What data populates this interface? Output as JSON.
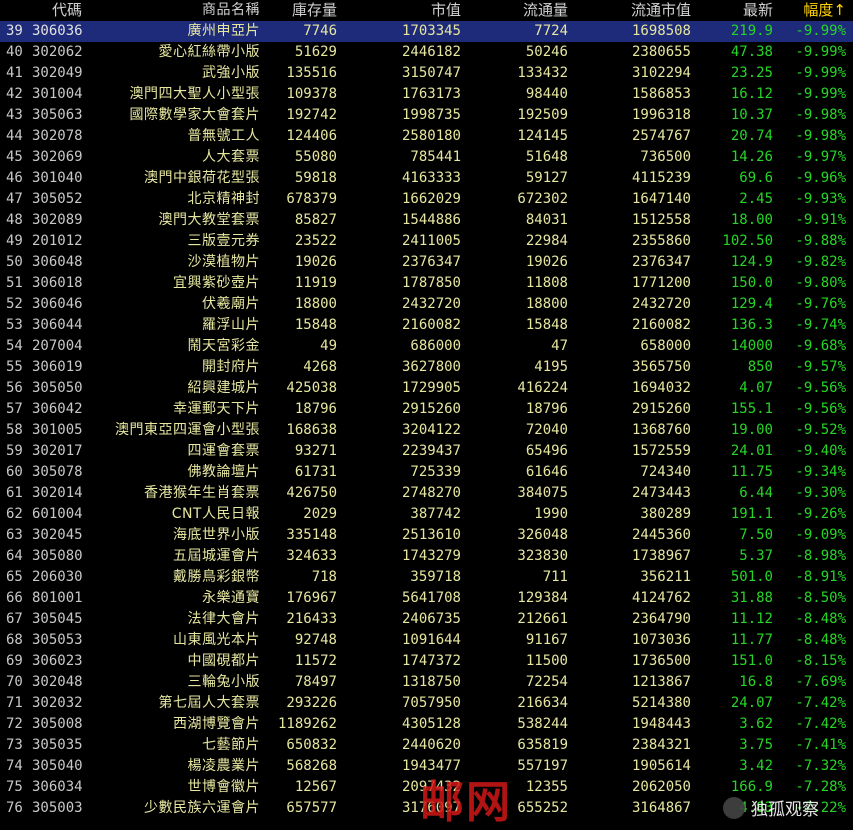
{
  "header": {
    "code": "代碼",
    "name": "商品名稱",
    "inventory": "庫存量",
    "market_value": "市值",
    "circulation": "流通量",
    "circ_market_value": "流通市值",
    "last": "最新",
    "change": "幅度↑"
  },
  "rows": [
    {
      "idx": "39",
      "code": "306036",
      "name": "廣州申亞片",
      "inventory": "7746",
      "market_value": "1703345",
      "circulation": "7724",
      "circ_market_value": "1698508",
      "last": "219.9",
      "change": "-9.99%"
    },
    {
      "idx": "40",
      "code": "302062",
      "name": "愛心紅絲帶小版",
      "inventory": "51629",
      "market_value": "2446182",
      "circulation": "50246",
      "circ_market_value": "2380655",
      "last": "47.38",
      "change": "-9.99%"
    },
    {
      "idx": "41",
      "code": "302049",
      "name": "武強小版",
      "inventory": "135516",
      "market_value": "3150747",
      "circulation": "133432",
      "circ_market_value": "3102294",
      "last": "23.25",
      "change": "-9.99%"
    },
    {
      "idx": "42",
      "code": "301004",
      "name": "澳門四大聖人小型張",
      "inventory": "109378",
      "market_value": "1763173",
      "circulation": "98440",
      "circ_market_value": "1586853",
      "last": "16.12",
      "change": "-9.99%"
    },
    {
      "idx": "43",
      "code": "305063",
      "name": "國際數學家大會套片",
      "inventory": "192742",
      "market_value": "1998735",
      "circulation": "192509",
      "circ_market_value": "1996318",
      "last": "10.37",
      "change": "-9.98%"
    },
    {
      "idx": "44",
      "code": "302078",
      "name": "普無號工人",
      "inventory": "124406",
      "market_value": "2580180",
      "circulation": "124145",
      "circ_market_value": "2574767",
      "last": "20.74",
      "change": "-9.98%"
    },
    {
      "idx": "45",
      "code": "302069",
      "name": "人大套票",
      "inventory": "55080",
      "market_value": "785441",
      "circulation": "51648",
      "circ_market_value": "736500",
      "last": "14.26",
      "change": "-9.97%"
    },
    {
      "idx": "46",
      "code": "301040",
      "name": "澳門中銀荷花型張",
      "inventory": "59818",
      "market_value": "4163333",
      "circulation": "59127",
      "circ_market_value": "4115239",
      "last": "69.6",
      "change": "-9.96%"
    },
    {
      "idx": "47",
      "code": "305052",
      "name": "北京精神封",
      "inventory": "678379",
      "market_value": "1662029",
      "circulation": "672302",
      "circ_market_value": "1647140",
      "last": "2.45",
      "change": "-9.93%"
    },
    {
      "idx": "48",
      "code": "302089",
      "name": "澳門大教堂套票",
      "inventory": "85827",
      "market_value": "1544886",
      "circulation": "84031",
      "circ_market_value": "1512558",
      "last": "18.00",
      "change": "-9.91%"
    },
    {
      "idx": "49",
      "code": "201012",
      "name": "三版壹元券",
      "inventory": "23522",
      "market_value": "2411005",
      "circulation": "22984",
      "circ_market_value": "2355860",
      "last": "102.50",
      "change": "-9.88%"
    },
    {
      "idx": "50",
      "code": "306048",
      "name": "沙漠植物片",
      "inventory": "19026",
      "market_value": "2376347",
      "circulation": "19026",
      "circ_market_value": "2376347",
      "last": "124.9",
      "change": "-9.82%"
    },
    {
      "idx": "51",
      "code": "306018",
      "name": "宜興紫砂壺片",
      "inventory": "11919",
      "market_value": "1787850",
      "circulation": "11808",
      "circ_market_value": "1771200",
      "last": "150.0",
      "change": "-9.80%"
    },
    {
      "idx": "52",
      "code": "306046",
      "name": "伏羲廟片",
      "inventory": "18800",
      "market_value": "2432720",
      "circulation": "18800",
      "circ_market_value": "2432720",
      "last": "129.4",
      "change": "-9.76%"
    },
    {
      "idx": "53",
      "code": "306044",
      "name": "羅浮山片",
      "inventory": "15848",
      "market_value": "2160082",
      "circulation": "15848",
      "circ_market_value": "2160082",
      "last": "136.3",
      "change": "-9.74%"
    },
    {
      "idx": "54",
      "code": "207004",
      "name": "鬧天宮彩金",
      "inventory": "49",
      "market_value": "686000",
      "circulation": "47",
      "circ_market_value": "658000",
      "last": "14000",
      "change": "-9.68%"
    },
    {
      "idx": "55",
      "code": "306019",
      "name": "開封府片",
      "inventory": "4268",
      "market_value": "3627800",
      "circulation": "4195",
      "circ_market_value": "3565750",
      "last": "850",
      "change": "-9.57%"
    },
    {
      "idx": "56",
      "code": "305050",
      "name": "紹興建城片",
      "inventory": "425038",
      "market_value": "1729905",
      "circulation": "416224",
      "circ_market_value": "1694032",
      "last": "4.07",
      "change": "-9.56%"
    },
    {
      "idx": "57",
      "code": "306042",
      "name": "幸運郵天下片",
      "inventory": "18796",
      "market_value": "2915260",
      "circulation": "18796",
      "circ_market_value": "2915260",
      "last": "155.1",
      "change": "-9.56%"
    },
    {
      "idx": "58",
      "code": "301005",
      "name": "澳門東亞四運會小型張",
      "inventory": "168638",
      "market_value": "3204122",
      "circulation": "72040",
      "circ_market_value": "1368760",
      "last": "19.00",
      "change": "-9.52%"
    },
    {
      "idx": "59",
      "code": "302017",
      "name": "四運會套票",
      "inventory": "93271",
      "market_value": "2239437",
      "circulation": "65496",
      "circ_market_value": "1572559",
      "last": "24.01",
      "change": "-9.40%"
    },
    {
      "idx": "60",
      "code": "305078",
      "name": "佛教論壇片",
      "inventory": "61731",
      "market_value": "725339",
      "circulation": "61646",
      "circ_market_value": "724340",
      "last": "11.75",
      "change": "-9.34%"
    },
    {
      "idx": "61",
      "code": "302014",
      "name": "香港猴年生肖套票",
      "inventory": "426750",
      "market_value": "2748270",
      "circulation": "384075",
      "circ_market_value": "2473443",
      "last": "6.44",
      "change": "-9.30%"
    },
    {
      "idx": "62",
      "code": "601004",
      "name": "CNT人民日報",
      "inventory": "2029",
      "market_value": "387742",
      "circulation": "1990",
      "circ_market_value": "380289",
      "last": "191.1",
      "change": "-9.26%"
    },
    {
      "idx": "63",
      "code": "302045",
      "name": "海底世界小版",
      "inventory": "335148",
      "market_value": "2513610",
      "circulation": "326048",
      "circ_market_value": "2445360",
      "last": "7.50",
      "change": "-9.09%"
    },
    {
      "idx": "64",
      "code": "305080",
      "name": "五屆城運會片",
      "inventory": "324633",
      "market_value": "1743279",
      "circulation": "323830",
      "circ_market_value": "1738967",
      "last": "5.37",
      "change": "-8.98%"
    },
    {
      "idx": "65",
      "code": "206030",
      "name": "戴勝鳥彩銀幣",
      "inventory": "718",
      "market_value": "359718",
      "circulation": "711",
      "circ_market_value": "356211",
      "last": "501.0",
      "change": "-8.91%"
    },
    {
      "idx": "66",
      "code": "801001",
      "name": "永樂通寶",
      "inventory": "176967",
      "market_value": "5641708",
      "circulation": "129384",
      "circ_market_value": "4124762",
      "last": "31.88",
      "change": "-8.50%"
    },
    {
      "idx": "67",
      "code": "305045",
      "name": "法律大會片",
      "inventory": "216433",
      "market_value": "2406735",
      "circulation": "212661",
      "circ_market_value": "2364790",
      "last": "11.12",
      "change": "-8.48%"
    },
    {
      "idx": "68",
      "code": "305053",
      "name": "山東風光本片",
      "inventory": "92748",
      "market_value": "1091644",
      "circulation": "91167",
      "circ_market_value": "1073036",
      "last": "11.77",
      "change": "-8.48%"
    },
    {
      "idx": "69",
      "code": "306023",
      "name": "中國硯都片",
      "inventory": "11572",
      "market_value": "1747372",
      "circulation": "11500",
      "circ_market_value": "1736500",
      "last": "151.0",
      "change": "-8.15%"
    },
    {
      "idx": "70",
      "code": "302048",
      "name": "三輪兔小版",
      "inventory": "78497",
      "market_value": "1318750",
      "circulation": "72254",
      "circ_market_value": "1213867",
      "last": "16.8",
      "change": "-7.69%"
    },
    {
      "idx": "71",
      "code": "302032",
      "name": "第七屆人大套票",
      "inventory": "293226",
      "market_value": "7057950",
      "circulation": "216634",
      "circ_market_value": "5214380",
      "last": "24.07",
      "change": "-7.42%"
    },
    {
      "idx": "72",
      "code": "305008",
      "name": "西湖博覽會片",
      "inventory": "1189262",
      "market_value": "4305128",
      "circulation": "538244",
      "circ_market_value": "1948443",
      "last": "3.62",
      "change": "-7.42%"
    },
    {
      "idx": "73",
      "code": "305035",
      "name": "七藝節片",
      "inventory": "650832",
      "market_value": "2440620",
      "circulation": "635819",
      "circ_market_value": "2384321",
      "last": "3.75",
      "change": "-7.41%"
    },
    {
      "idx": "74",
      "code": "305040",
      "name": "楊凌農業片",
      "inventory": "568268",
      "market_value": "1943477",
      "circulation": "557197",
      "circ_market_value": "1905614",
      "last": "3.42",
      "change": "-7.32%"
    },
    {
      "idx": "75",
      "code": "306034",
      "name": "世博會徽片",
      "inventory": "12567",
      "market_value": "2097432",
      "circulation": "12355",
      "circ_market_value": "2062050",
      "last": "166.9",
      "change": "-7.28%"
    },
    {
      "idx": "76",
      "code": "305003",
      "name": "少數民族六運會片",
      "inventory": "657577",
      "market_value": "3176097",
      "circulation": "655252",
      "circ_market_value": "3164867",
      "last": "4.83",
      "change": "-7.22%"
    }
  ],
  "watermark": {
    "text": "独孤观察",
    "red_text": "邮网"
  }
}
